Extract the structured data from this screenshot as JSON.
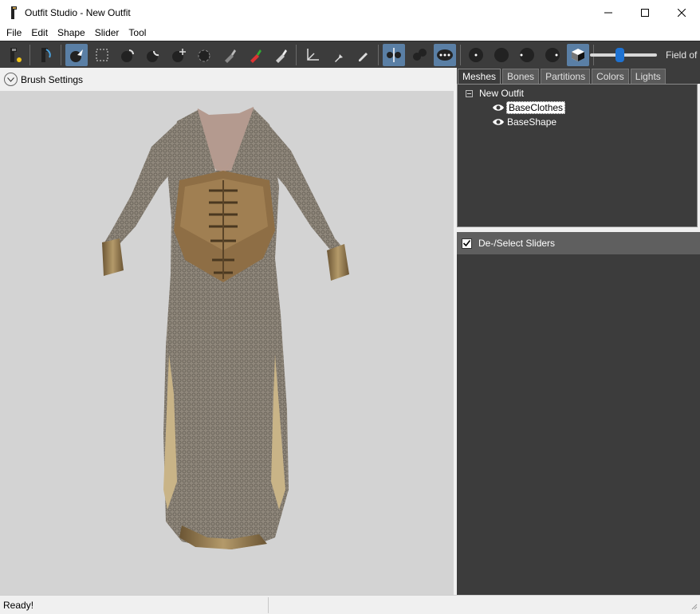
{
  "window": {
    "title": "Outfit Studio - New Outfit"
  },
  "menu": [
    "File",
    "Edit",
    "Shape",
    "Slider",
    "Tool"
  ],
  "toolbar": {
    "field_of_view_label": "Field of",
    "field_of_view_level": 0.45,
    "buttons": [
      {
        "name": "new-project-icon",
        "active": false
      },
      {
        "name": "load-reference-icon",
        "active": false
      },
      {
        "name": "select-brush-icon",
        "active": true
      },
      {
        "name": "mask-brush-icon",
        "active": false
      },
      {
        "name": "inflate-brush-icon",
        "active": false
      },
      {
        "name": "deflate-brush-icon",
        "active": false
      },
      {
        "name": "move-brush-icon",
        "active": false
      },
      {
        "name": "smooth-brush-icon",
        "active": false
      },
      {
        "name": "weight-brush-icon",
        "active": false
      },
      {
        "name": "color-brush-icon",
        "active": false
      },
      {
        "name": "alpha-brush-icon",
        "active": false
      },
      {
        "name": "transform-icon",
        "active": false
      },
      {
        "name": "pivot-icon",
        "active": false
      },
      {
        "name": "vertex-edit-icon",
        "active": false
      },
      {
        "name": "x-mirror-icon",
        "active": true
      },
      {
        "name": "connected-only-icon",
        "active": false
      },
      {
        "name": "global-brush-icon",
        "active": true
      },
      {
        "name": "show-vertices-icon",
        "active": false
      },
      {
        "name": "shaded-view-icon",
        "active": false
      },
      {
        "name": "wireframe-icon",
        "active": false
      },
      {
        "name": "lighting-icon",
        "active": false
      },
      {
        "name": "texture-icon",
        "active": true
      }
    ]
  },
  "brush_settings": {
    "label": "Brush Settings"
  },
  "tabs": [
    "Meshes",
    "Bones",
    "Partitions",
    "Colors",
    "Lights"
  ],
  "active_tab": "Meshes",
  "mesh_tree": {
    "root": "New Outfit",
    "items": [
      {
        "label": "BaseClothes",
        "selected": true
      },
      {
        "label": "BaseShape",
        "selected": false
      }
    ]
  },
  "sliders_panel": {
    "label": "De-/Select Sliders",
    "checked": true
  },
  "status": {
    "text": "Ready!"
  },
  "colors": {
    "dark_panel": "#3c3c3c",
    "accent": "#5a7fa5",
    "slider_thumb": "#1e72d2",
    "viewport": "#d3d3d3"
  }
}
